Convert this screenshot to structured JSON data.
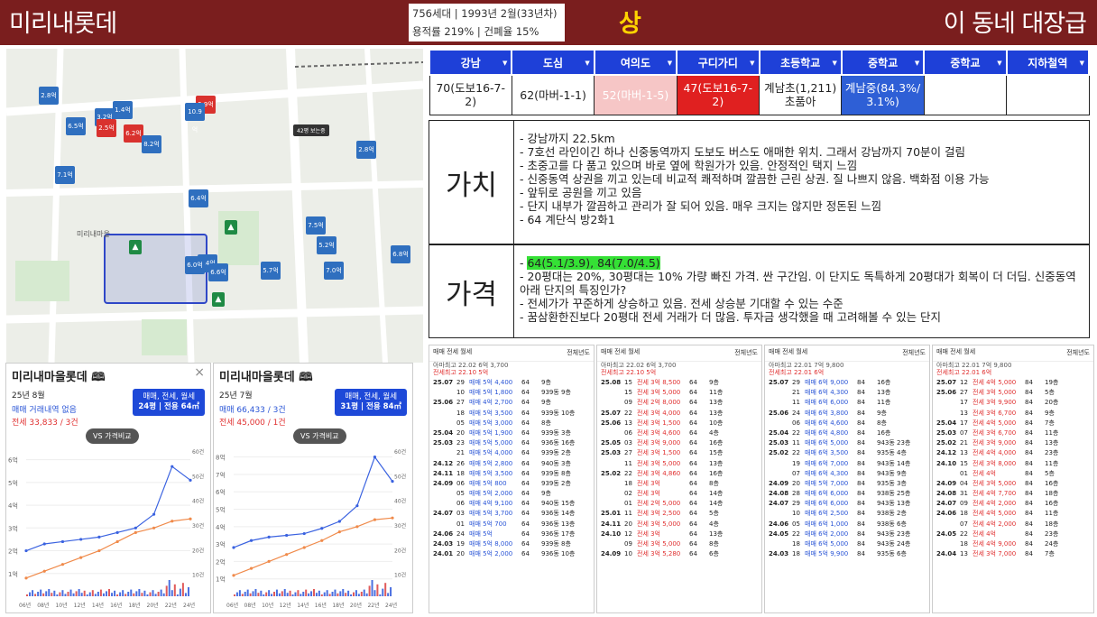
{
  "header": {
    "apt_name": "미리내롯데",
    "info_line1": "756세대 | 1993년 2월(33년차)",
    "info_line2": "용적률 219% | 건폐율 15%",
    "grade": "상",
    "slogan": "이 동네 대장급"
  },
  "commute": {
    "headers": [
      "강남",
      "도심",
      "여의도",
      "구디가디",
      "초등학교",
      "중학교",
      "중학교",
      "지하철역"
    ],
    "values": [
      "70(도보16-7-2)",
      "62(마버-1-1)",
      "52(마버-1-5)",
      "47(도보16-7-2)",
      "계남초(1,211)\n초품아",
      "계남중(84.3%/\n3.1%)",
      "",
      ""
    ]
  },
  "value_section": {
    "label": "가치",
    "items": [
      "강남까지 22.5km",
      "7호선 라인이긴 하나 신중동역까지 도보도 버스도 애매한 위치. 그래서 강남까지 70분이 걸림",
      "초중고를 다 품고 있으며 바로 옆에 학원가가 있음. 안정적인 택지 느낌",
      "신중동역 상권을 끼고 있는데 비교적 쾌적하며 깔끔한 근린 상권. 질 나쁘지 않음. 백화점 이용 가능",
      "앞뒤로 공원을 끼고 있음",
      "단지 내부가 깔끔하고 관리가 잘 되어 있음. 매우 크지는 않지만 정돈된 느낌",
      "64 계단식 방2화1"
    ]
  },
  "price_section": {
    "label": "가격",
    "items": [
      "64(5.1/3.9), 84(7.0/4.5)",
      "20평대는 20%, 30평대는 10% 가량 빠진 가격. 싼 구간임. 이 단지도 독특하게 20평대가 회복이 더 더딤. 신중동역 아래 단지의 특징인가?",
      "전세가가 꾸준하게 상승하고 있음. 전세 상승분 기대할 수 있는 수준",
      "꿈삼환한진보다 20평대 전세 거래가 더 많음. 투자금 생각했을 때 고려해볼 수 있는 단지"
    ]
  },
  "map": {
    "markers": [
      "2.8억",
      "6.5억",
      "3.2억",
      "1.4억",
      "2.5억",
      "6.2억",
      "8.2억",
      "5.9억",
      "10.9억",
      "2.8억",
      "7.1억",
      "6.4억",
      "7.5억",
      "5.2억",
      "6.8억",
      "7.0억",
      "5.7억",
      "9.4억",
      "6.6억",
      "6.0억"
    ],
    "badge": "42평 보는중",
    "place": "미리내마을"
  },
  "chart_left": {
    "title": "미리내마을롯데",
    "date": "25년 8월",
    "type_btn": "매매, 전세, 월세",
    "size_btn": "24평 | 전용 64㎡",
    "trade_line": "매매 거래내역 없음",
    "rent_line": "전세 33,833 / 3건",
    "vs": "VS 가격비교",
    "yticks": [
      "6억",
      "5억",
      "4억",
      "3억",
      "2억",
      "1억"
    ],
    "y2ticks": [
      "60건",
      "50건",
      "40건",
      "30건",
      "20건",
      "10건"
    ],
    "xticks": [
      "06년",
      "08년",
      "10년",
      "12년",
      "14년",
      "16년",
      "18년",
      "20년",
      "22년",
      "24년"
    ]
  },
  "chart_right": {
    "title": "미리내마을롯데",
    "date": "25년 7월",
    "type_btn": "매매, 전세, 월세",
    "size_btn": "31평 | 전용 84㎡",
    "trade_line": "매매 66,433 / 3건",
    "rent_line": "전세 45,000 / 1건",
    "vs": "VS 가격비교",
    "yticks": [
      "8억",
      "7억",
      "6억",
      "5억",
      "4억",
      "3억",
      "2억",
      "1억"
    ],
    "y2ticks": [
      "60건",
      "50건",
      "40건",
      "30건",
      "20건",
      "10건"
    ],
    "xticks": [
      "06년",
      "08년",
      "10년",
      "12년",
      "14년",
      "16년",
      "18년",
      "20년",
      "22년",
      "24년"
    ]
  },
  "chart_data": [
    {
      "type": "line",
      "title": "미리내마을롯데",
      "ylim": [
        0,
        6.5
      ],
      "x": [
        "06년",
        "08년",
        "10년",
        "12년",
        "14년",
        "16년",
        "18년",
        "20년",
        "22년",
        "24년"
      ],
      "series": [
        {
          "values": [
            2.0,
            2.3,
            2.4,
            2.5,
            2.6,
            2.8,
            3.0,
            3.6,
            5.7,
            5.1
          ]
        },
        {
          "values": [
            0.8,
            1.1,
            1.4,
            1.7,
            2.0,
            2.4,
            2.8,
            3.0,
            3.3,
            3.4
          ]
        }
      ]
    },
    {
      "type": "line",
      "title": "미리내마을롯데",
      "ylim": [
        0,
        8.5
      ],
      "x": [
        "06년",
        "08년",
        "10년",
        "12년",
        "14년",
        "16년",
        "18년",
        "20년",
        "22년",
        "24년"
      ],
      "series": [
        {
          "values": [
            2.8,
            3.2,
            3.4,
            3.5,
            3.6,
            3.9,
            4.3,
            5.2,
            8.0,
            6.6
          ]
        },
        {
          "values": [
            1.2,
            1.6,
            2.0,
            2.4,
            2.8,
            3.2,
            3.7,
            4.0,
            4.4,
            4.5
          ]
        }
      ]
    }
  ],
  "tx_panels": [
    {
      "year": "전체년도",
      "meta1": "아마최고 22.02 6억 3,700",
      "meta2": "전세최고 22.10 5억",
      "rows": [
        [
          "25.07",
          "29",
          "매매 5억 4,400",
          "64",
          "9층"
        ],
        [
          "",
          "10",
          "매매 5억 1,800",
          "64",
          "939동 9층"
        ],
        [
          "25.06",
          "27",
          "매매 4억 2,700",
          "64",
          "9층"
        ],
        [
          "",
          "18",
          "매매 5억 3,500",
          "64",
          "939동 10층"
        ],
        [
          "",
          "05",
          "매매 5억 3,000",
          "64",
          "8층"
        ],
        [
          "25.04",
          "20",
          "매매 5억 1,900",
          "64",
          "939동 3층"
        ],
        [
          "25.03",
          "23",
          "매매 5억 5,000",
          "64",
          "936동 16층"
        ],
        [
          "",
          "21",
          "매매 5억 4,000",
          "64",
          "939동 2층"
        ],
        [
          "24.12",
          "26",
          "매매 5억 2,800",
          "64",
          "940동 3층"
        ],
        [
          "24.11",
          "18",
          "매매 5억 3,500",
          "64",
          "939동 8층"
        ],
        [
          "24.09",
          "06",
          "매매 5억 800",
          "64",
          "939동 2층"
        ],
        [
          "",
          "05",
          "매매 5억 2,000",
          "64",
          "9층"
        ],
        [
          "",
          "06",
          "매매 4억 9,100",
          "64",
          "940동 15층"
        ],
        [
          "24.07",
          "03",
          "매매 5억 3,700",
          "64",
          "936동 14층"
        ],
        [
          "",
          "01",
          "매매 5억 700",
          "64",
          "936동 13층"
        ],
        [
          "24.06",
          "24",
          "매매 5억",
          "64",
          "936동 17층"
        ],
        [
          "24.03",
          "19",
          "매매 5억 8,000",
          "64",
          "939동 8층"
        ],
        [
          "24.01",
          "20",
          "매매 5억 2,000",
          "64",
          "936동 10층"
        ]
      ]
    },
    {
      "year": "전체년도",
      "meta1": "아마최고 22.02 6억 3,700",
      "meta2": "전세최고 22.10 5억",
      "rows": [
        [
          "25.08",
          "15",
          "전세 3억 8,500",
          "64",
          "9층"
        ],
        [
          "",
          "15",
          "전세 3억 5,000",
          "64",
          "11층"
        ],
        [
          "",
          "09",
          "전세 2억 8,000",
          "64",
          "13층"
        ],
        [
          "25.07",
          "22",
          "전세 3억 4,000",
          "64",
          "13층"
        ],
        [
          "25.06",
          "13",
          "전세 3억 1,500",
          "64",
          "10층"
        ],
        [
          "",
          "06",
          "전세 3억 4,600",
          "64",
          "4층"
        ],
        [
          "25.05",
          "03",
          "전세 3억 9,000",
          "64",
          "16층"
        ],
        [
          "25.03",
          "27",
          "전세 3억 1,500",
          "64",
          "15층"
        ],
        [
          "",
          "11",
          "전세 3억 5,000",
          "64",
          "13층"
        ],
        [
          "25.02",
          "22",
          "전세 3억 4,860",
          "64",
          "16층"
        ],
        [
          "",
          "18",
          "전세 3억",
          "64",
          "8층"
        ],
        [
          "",
          "02",
          "전세 3억",
          "64",
          "14층"
        ],
        [
          "",
          "01",
          "전세 2억 5,000",
          "64",
          "14층"
        ],
        [
          "25.01",
          "11",
          "전세 3억 2,500",
          "64",
          "5층"
        ],
        [
          "24.11",
          "20",
          "전세 3억 5,000",
          "64",
          "4층"
        ],
        [
          "24.10",
          "12",
          "전세 3억",
          "64",
          "13층"
        ],
        [
          "",
          "09",
          "전세 3억 5,000",
          "64",
          "8층"
        ],
        [
          "24.09",
          "10",
          "전세 3억 5,280",
          "64",
          "6층"
        ]
      ]
    },
    {
      "year": "전체년도",
      "meta1": "아마최고 22.01 7억 9,800",
      "meta2": "전세최고 22.01 6억",
      "rows": [
        [
          "25.07",
          "29",
          "매매 6억 9,000",
          "84",
          "16층"
        ],
        [
          "",
          "21",
          "매매 6억 4,300",
          "84",
          "13층"
        ],
        [
          "",
          "11",
          "매매 6억 6,000",
          "84",
          "11층"
        ],
        [
          "25.06",
          "24",
          "매매 6억 3,800",
          "84",
          "9층"
        ],
        [
          "",
          "06",
          "매매 6억 4,600",
          "84",
          "8층"
        ],
        [
          "25.04",
          "22",
          "매매 6억 4,800",
          "84",
          "16층"
        ],
        [
          "25.03",
          "11",
          "매매 6억 5,000",
          "84",
          "943동 23층"
        ],
        [
          "25.02",
          "22",
          "매매 6억 3,500",
          "84",
          "935동 4층"
        ],
        [
          "",
          "19",
          "매매 6억 7,000",
          "84",
          "943동 14층"
        ],
        [
          "",
          "07",
          "매매 6억 4,300",
          "84",
          "943동 9층"
        ],
        [
          "24.09",
          "20",
          "매매 5억 7,000",
          "84",
          "935동 3층"
        ],
        [
          "24.08",
          "28",
          "매매 6억 6,000",
          "84",
          "938동 25층"
        ],
        [
          "24.07",
          "29",
          "매매 6억 6,000",
          "84",
          "943동 13층"
        ],
        [
          "",
          "10",
          "매매 6억 2,500",
          "84",
          "938동 2층"
        ],
        [
          "24.06",
          "05",
          "매매 6억 1,000",
          "84",
          "938동 6층"
        ],
        [
          "24.05",
          "22",
          "매매 6억 2,000",
          "84",
          "943동 23층"
        ],
        [
          "",
          "18",
          "매매 6억 5,000",
          "84",
          "943동 24층"
        ],
        [
          "24.03",
          "18",
          "매매 5억 9,900",
          "84",
          "935동 6층"
        ]
      ]
    },
    {
      "year": "전체년도",
      "meta1": "아마최고 22.01 7억 9,800",
      "meta2": "전세최고 22.01 6억",
      "rows": [
        [
          "25.07",
          "12",
          "전세 4억 5,000",
          "84",
          "19층"
        ],
        [
          "25.06",
          "27",
          "전세 3억 5,000",
          "84",
          "5층"
        ],
        [
          "",
          "17",
          "전세 3억 9,900",
          "84",
          "20층"
        ],
        [
          "",
          "13",
          "전세 3억 6,700",
          "84",
          "9층"
        ],
        [
          "25.04",
          "17",
          "전세 4억 5,000",
          "84",
          "7층"
        ],
        [
          "25.03",
          "07",
          "전세 3억 6,700",
          "84",
          "11층"
        ],
        [
          "25.02",
          "21",
          "전세 3억 9,000",
          "84",
          "13층"
        ],
        [
          "24.12",
          "13",
          "전세 4억 4,000",
          "84",
          "23층"
        ],
        [
          "24.10",
          "15",
          "전세 3억 8,000",
          "84",
          "11층"
        ],
        [
          "",
          "01",
          "전세 4억",
          "84",
          "5층"
        ],
        [
          "24.09",
          "04",
          "전세 3억 5,000",
          "84",
          "16층"
        ],
        [
          "24.08",
          "31",
          "전세 4억 7,700",
          "84",
          "18층"
        ],
        [
          "24.07",
          "09",
          "전세 4억 2,000",
          "84",
          "16층"
        ],
        [
          "24.06",
          "18",
          "전세 4억 5,000",
          "84",
          "11층"
        ],
        [
          "",
          "07",
          "전세 4억 2,000",
          "84",
          "18층"
        ],
        [
          "24.05",
          "22",
          "전세 4억",
          "84",
          "23층"
        ],
        [
          "",
          "18",
          "전세 4억 9,000",
          "84",
          "24층"
        ],
        [
          "24.04",
          "13",
          "전세 3억 7,000",
          "84",
          "7층"
        ]
      ]
    }
  ]
}
